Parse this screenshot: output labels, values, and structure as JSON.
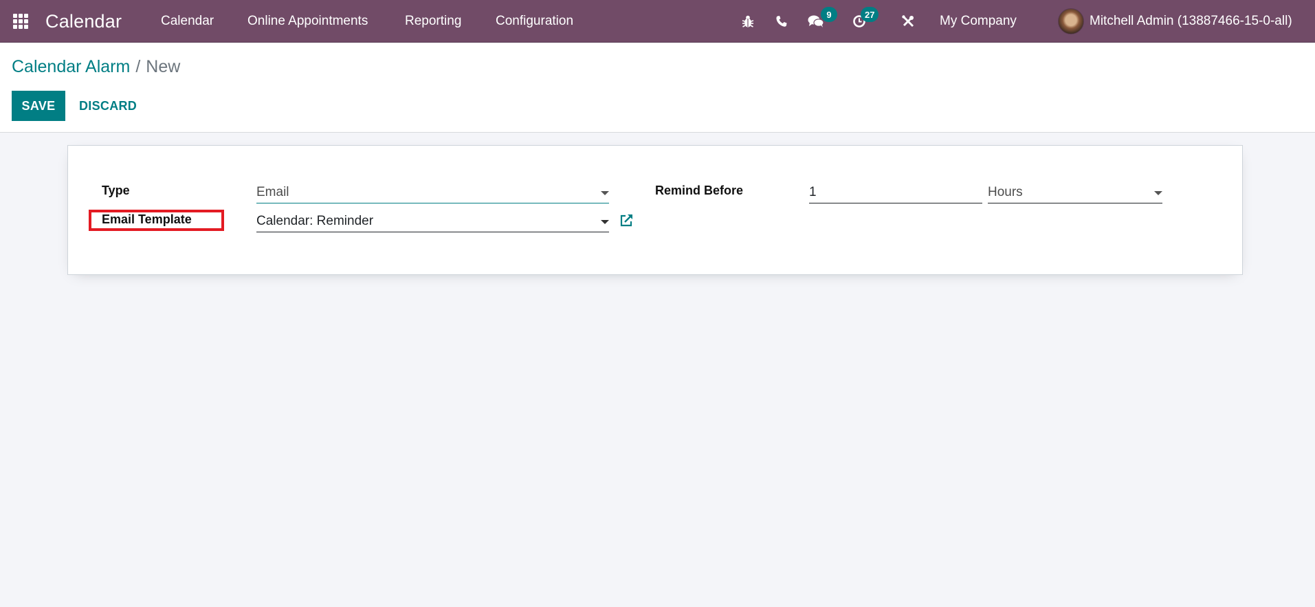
{
  "navbar": {
    "apps_icon": "apps-grid-icon",
    "app_name": "Calendar",
    "menu": [
      {
        "label": "Calendar"
      },
      {
        "label": "Online Appointments"
      },
      {
        "label": "Reporting"
      },
      {
        "label": "Configuration"
      }
    ],
    "systray": {
      "debug_icon": "bug-icon",
      "phone_icon": "phone-icon",
      "messages_icon": "chat-icon",
      "messages_count": "9",
      "activities_icon": "clock-icon",
      "activities_count": "27",
      "tools_icon": "tools-icon",
      "company": "My Company",
      "user": "Mitchell Admin (13887466-15-0-all)"
    }
  },
  "control_panel": {
    "breadcrumb": {
      "parent": "Calendar Alarm",
      "separator": "/",
      "current": "New"
    },
    "save_label": "SAVE",
    "discard_label": "DISCARD"
  },
  "form": {
    "type": {
      "label": "Type",
      "value": "Email"
    },
    "email_template": {
      "label": "Email Template",
      "value": "Calendar: Reminder",
      "external_icon": "external-link-icon"
    },
    "remind_before": {
      "label": "Remind Before",
      "value": "1",
      "unit": "Hours"
    }
  },
  "colors": {
    "navbar": "#714b67",
    "primary": "#017e84",
    "highlight": "#e31b23"
  }
}
